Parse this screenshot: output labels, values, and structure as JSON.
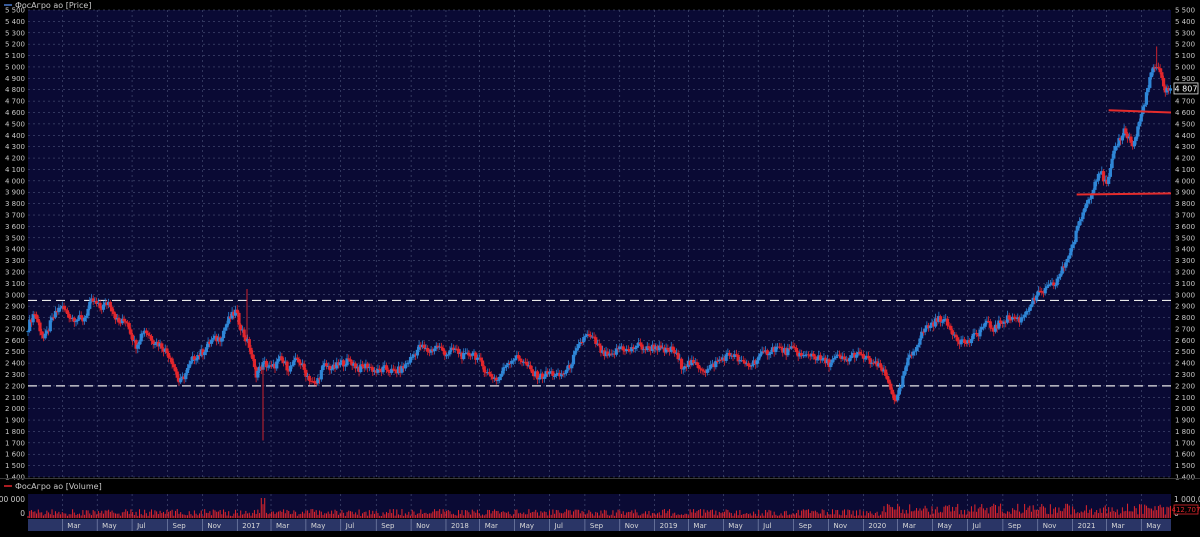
{
  "price_panel": {
    "title": "ФосАгро ао [Price]",
    "last_value_label": "4 807"
  },
  "volume_panel": {
    "title": "ФосАгро ао [Volume]",
    "right_tick_labels": [
      "1 000,000",
      "0"
    ],
    "left_tick_labels": [
      "100 000",
      "0"
    ],
    "last_value_label": "412,707"
  },
  "colors": {
    "background": "#000000",
    "plot_background": "#0a0a34",
    "grid": "#5a6488",
    "axis_text": "#c8c8c8",
    "up": "#2f86d6",
    "down": "#e2262c",
    "level_line": "#e8e8e8",
    "trend_line": "#e52c2c",
    "x_axis_bg": "#2a3566"
  },
  "chart_data": {
    "type": "candlestick",
    "title": "ФосАгро ао [Price]",
    "y_axis": {
      "min": 1400,
      "max": 5500,
      "step": 100,
      "tick_labels": [
        "1 400",
        "1 500",
        "1 600",
        "1 700",
        "1 800",
        "1 900",
        "2 000",
        "2 100",
        "2 200",
        "2 300",
        "2 400",
        "2 500",
        "2 600",
        "2 700",
        "2 800",
        "2 900",
        "3 000",
        "3 100",
        "3 200",
        "3 300",
        "3 400",
        "3 500",
        "3 600",
        "3 700",
        "3 800",
        "3 900",
        "4 000",
        "4 100",
        "4 200",
        "4 300",
        "4 400",
        "4 500",
        "4 600",
        "4 700",
        "4 800",
        "4 900",
        "5 000",
        "5 100",
        "5 200",
        "5 300",
        "5 400",
        "5 500"
      ]
    },
    "x_axis": {
      "start": "2016-01-01",
      "end": "2021-06-22",
      "ticks": [
        {
          "date": "2016-03-01",
          "label": "Mar"
        },
        {
          "date": "2016-05-01",
          "label": "May"
        },
        {
          "date": "2016-07-01",
          "label": "Jul"
        },
        {
          "date": "2016-09-01",
          "label": "Sep"
        },
        {
          "date": "2016-11-01",
          "label": "Nov"
        },
        {
          "date": "2017-01-01",
          "label": "2017"
        },
        {
          "date": "2017-03-01",
          "label": "Mar"
        },
        {
          "date": "2017-05-01",
          "label": "May"
        },
        {
          "date": "2017-07-01",
          "label": "Jul"
        },
        {
          "date": "2017-09-01",
          "label": "Sep"
        },
        {
          "date": "2017-11-01",
          "label": "Nov"
        },
        {
          "date": "2018-01-01",
          "label": "2018"
        },
        {
          "date": "2018-03-01",
          "label": "Mar"
        },
        {
          "date": "2018-05-01",
          "label": "May"
        },
        {
          "date": "2018-07-01",
          "label": "Jul"
        },
        {
          "date": "2018-09-01",
          "label": "Sep"
        },
        {
          "date": "2018-11-01",
          "label": "Nov"
        },
        {
          "date": "2019-01-01",
          "label": "2019"
        },
        {
          "date": "2019-03-01",
          "label": "Mar"
        },
        {
          "date": "2019-05-01",
          "label": "May"
        },
        {
          "date": "2019-07-01",
          "label": "Jul"
        },
        {
          "date": "2019-09-01",
          "label": "Sep"
        },
        {
          "date": "2019-11-01",
          "label": "Nov"
        },
        {
          "date": "2020-01-01",
          "label": "2020"
        },
        {
          "date": "2020-03-01",
          "label": "Mar"
        },
        {
          "date": "2020-05-01",
          "label": "May"
        },
        {
          "date": "2020-07-01",
          "label": "Jul"
        },
        {
          "date": "2020-09-01",
          "label": "Sep"
        },
        {
          "date": "2020-11-01",
          "label": "Nov"
        },
        {
          "date": "2021-01-01",
          "label": "2021"
        },
        {
          "date": "2021-03-01",
          "label": "Mar"
        },
        {
          "date": "2021-05-01",
          "label": "May"
        }
      ]
    },
    "price_path": [
      [
        "2016-01-01",
        2680
      ],
      [
        "2016-01-15",
        2850
      ],
      [
        "2016-02-01",
        2600
      ],
      [
        "2016-02-15",
        2780
      ],
      [
        "2016-03-01",
        2900
      ],
      [
        "2016-03-20",
        2800
      ],
      [
        "2016-04-10",
        2780
      ],
      [
        "2016-04-25",
        2950
      ],
      [
        "2016-05-10",
        2880
      ],
      [
        "2016-05-25",
        2940
      ],
      [
        "2016-06-10",
        2750
      ],
      [
        "2016-06-25",
        2780
      ],
      [
        "2016-07-10",
        2550
      ],
      [
        "2016-07-25",
        2700
      ],
      [
        "2016-08-10",
        2600
      ],
      [
        "2016-08-25",
        2550
      ],
      [
        "2016-09-10",
        2450
      ],
      [
        "2016-09-25",
        2220
      ],
      [
        "2016-10-05",
        2300
      ],
      [
        "2016-10-20",
        2450
      ],
      [
        "2016-11-05",
        2500
      ],
      [
        "2016-11-20",
        2600
      ],
      [
        "2016-12-05",
        2620
      ],
      [
        "2016-12-20",
        2780
      ],
      [
        "2017-01-01",
        2850
      ],
      [
        "2017-01-15",
        2650
      ],
      [
        "2017-01-25",
        2550
      ],
      [
        "2017-02-05",
        2300
      ],
      [
        "2017-02-20",
        2400
      ],
      [
        "2017-03-05",
        2350
      ],
      [
        "2017-03-20",
        2430
      ],
      [
        "2017-04-05",
        2350
      ],
      [
        "2017-04-20",
        2440
      ],
      [
        "2017-05-05",
        2300
      ],
      [
        "2017-05-20",
        2200
      ],
      [
        "2017-06-05",
        2380
      ],
      [
        "2017-06-20",
        2350
      ],
      [
        "2017-07-05",
        2400
      ],
      [
        "2017-07-20",
        2420
      ],
      [
        "2017-08-05",
        2350
      ],
      [
        "2017-08-20",
        2380
      ],
      [
        "2017-09-05",
        2320
      ],
      [
        "2017-09-20",
        2350
      ],
      [
        "2017-10-05",
        2320
      ],
      [
        "2017-10-20",
        2350
      ],
      [
        "2017-11-05",
        2450
      ],
      [
        "2017-11-20",
        2550
      ],
      [
        "2017-12-05",
        2500
      ],
      [
        "2017-12-20",
        2550
      ],
      [
        "2018-01-05",
        2480
      ],
      [
        "2018-01-20",
        2520
      ],
      [
        "2018-02-05",
        2450
      ],
      [
        "2018-02-20",
        2500
      ],
      [
        "2018-03-05",
        2400
      ],
      [
        "2018-03-20",
        2300
      ],
      [
        "2018-04-05",
        2250
      ],
      [
        "2018-04-20",
        2400
      ],
      [
        "2018-05-05",
        2450
      ],
      [
        "2018-05-20",
        2420
      ],
      [
        "2018-06-05",
        2300
      ],
      [
        "2018-06-20",
        2280
      ],
      [
        "2018-07-05",
        2320
      ],
      [
        "2018-07-20",
        2280
      ],
      [
        "2018-08-05",
        2340
      ],
      [
        "2018-08-20",
        2500
      ],
      [
        "2018-09-05",
        2650
      ],
      [
        "2018-09-20",
        2600
      ],
      [
        "2018-10-05",
        2480
      ],
      [
        "2018-10-20",
        2450
      ],
      [
        "2018-11-05",
        2550
      ],
      [
        "2018-11-20",
        2500
      ],
      [
        "2018-12-05",
        2560
      ],
      [
        "2018-12-20",
        2520
      ],
      [
        "2019-01-05",
        2550
      ],
      [
        "2019-01-20",
        2500
      ],
      [
        "2019-02-05",
        2520
      ],
      [
        "2019-02-20",
        2380
      ],
      [
        "2019-03-05",
        2400
      ],
      [
        "2019-03-20",
        2380
      ],
      [
        "2019-04-05",
        2330
      ],
      [
        "2019-04-20",
        2400
      ],
      [
        "2019-05-05",
        2450
      ],
      [
        "2019-05-20",
        2480
      ],
      [
        "2019-06-05",
        2400
      ],
      [
        "2019-06-20",
        2380
      ],
      [
        "2019-07-05",
        2450
      ],
      [
        "2019-07-20",
        2500
      ],
      [
        "2019-08-05",
        2540
      ],
      [
        "2019-08-20",
        2500
      ],
      [
        "2019-09-05",
        2520
      ],
      [
        "2019-09-20",
        2450
      ],
      [
        "2019-10-05",
        2480
      ],
      [
        "2019-10-20",
        2430
      ],
      [
        "2019-11-05",
        2400
      ],
      [
        "2019-11-20",
        2450
      ],
      [
        "2019-12-05",
        2420
      ],
      [
        "2019-12-20",
        2480
      ],
      [
        "2020-01-05",
        2450
      ],
      [
        "2020-01-20",
        2400
      ],
      [
        "2020-02-05",
        2350
      ],
      [
        "2020-02-20",
        2200
      ],
      [
        "2020-03-01",
        2050
      ],
      [
        "2020-03-10",
        2200
      ],
      [
        "2020-03-20",
        2400
      ],
      [
        "2020-04-05",
        2550
      ],
      [
        "2020-04-20",
        2700
      ],
      [
        "2020-05-05",
        2750
      ],
      [
        "2020-05-20",
        2800
      ],
      [
        "2020-06-05",
        2700
      ],
      [
        "2020-06-20",
        2600
      ],
      [
        "2020-07-05",
        2580
      ],
      [
        "2020-07-20",
        2650
      ],
      [
        "2020-08-05",
        2750
      ],
      [
        "2020-08-20",
        2700
      ],
      [
        "2020-09-05",
        2780
      ],
      [
        "2020-09-20",
        2800
      ],
      [
        "2020-10-05",
        2780
      ],
      [
        "2020-10-20",
        2900
      ],
      [
        "2020-11-05",
        3000
      ],
      [
        "2020-11-20",
        3050
      ],
      [
        "2020-12-05",
        3100
      ],
      [
        "2020-12-20",
        3250
      ],
      [
        "2021-01-05",
        3450
      ],
      [
        "2021-01-20",
        3700
      ],
      [
        "2021-02-05",
        3900
      ],
      [
        "2021-02-20",
        4100
      ],
      [
        "2021-03-05",
        3950
      ],
      [
        "2021-03-20",
        4300
      ],
      [
        "2021-04-05",
        4450
      ],
      [
        "2021-04-20",
        4300
      ],
      [
        "2021-05-05",
        4600
      ],
      [
        "2021-05-15",
        4800
      ],
      [
        "2021-05-25",
        5000
      ],
      [
        "2021-06-05",
        4950
      ],
      [
        "2021-06-15",
        4800
      ],
      [
        "2021-06-22",
        4807
      ]
    ],
    "spikes": [
      {
        "date": "2017-01-18",
        "high": 3050
      },
      {
        "date": "2017-02-15",
        "low": 1720
      },
      {
        "date": "2021-05-28",
        "high": 5180
      }
    ],
    "horizontal_lines": [
      {
        "value": 2950,
        "style": "dashed",
        "color": "#e8e8e8"
      },
      {
        "value": 2200,
        "style": "dashed",
        "color": "#e8e8e8"
      }
    ],
    "trend_lines": [
      {
        "from": [
          "2021-01-08",
          3880
        ],
        "to": [
          "2021-06-22",
          3890
        ],
        "color": "#e52c2c"
      },
      {
        "from": [
          "2021-03-05",
          4620
        ],
        "to": [
          "2021-06-22",
          4600
        ],
        "color": "#e52c2c"
      }
    ],
    "last_value": 4807,
    "volume": {
      "title": "ФосАгро ао [Volume]",
      "max": 1000000,
      "last_value": 412707
    }
  }
}
